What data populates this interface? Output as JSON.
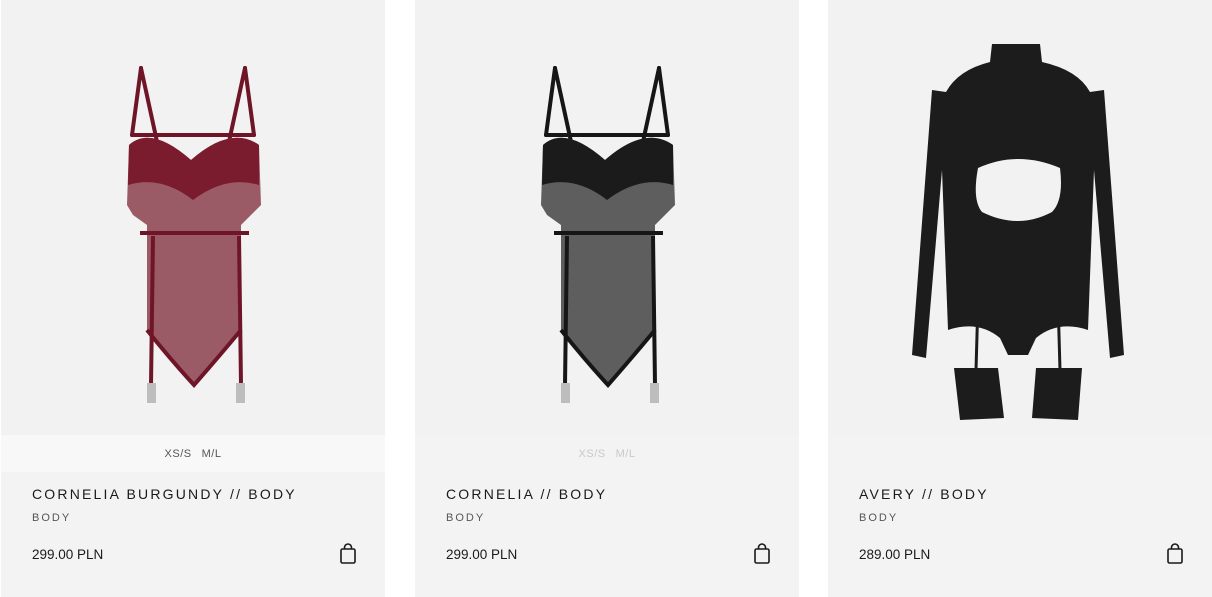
{
  "products": [
    {
      "name": "CORNELIA BURGUNDY // BODY",
      "category": "BODY",
      "price": "299.00 PLN",
      "sizes": [
        "XS/S",
        "M/L"
      ],
      "color": "#7a1b2e",
      "sheer_color": "#9a5a66",
      "image": "burgundy-lingerie-body"
    },
    {
      "name": "CORNELIA // BODY",
      "category": "BODY",
      "price": "299.00 PLN",
      "sizes": [
        "XS/S",
        "M/L"
      ],
      "color": "#1b1b1b",
      "sheer_color": "#5e5e5e",
      "image": "black-lingerie-body"
    },
    {
      "name": "AVERY // BODY",
      "category": "BODY",
      "price": "289.00 PLN",
      "sizes": [],
      "color": "#1c1c1c",
      "image": "black-long-sleeve-cutout-body"
    }
  ],
  "icons": {
    "cart": "shopping-bag-icon"
  }
}
